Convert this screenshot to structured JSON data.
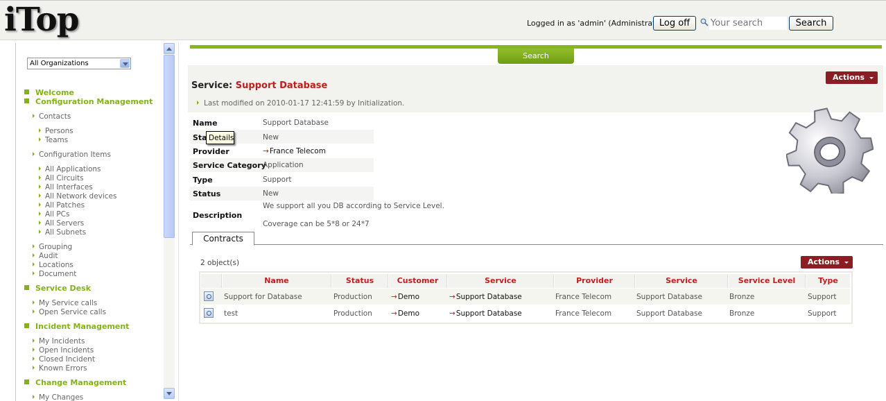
{
  "header": {
    "logo": "iTop",
    "login_text": "Logged in as 'admin' (Administrator)",
    "logoff_label": "Log off",
    "search_placeholder": "Your search",
    "search_button": "Search"
  },
  "sidebar": {
    "org_select": "All Organizations",
    "sections": [
      {
        "label": "Welcome"
      },
      {
        "label": "Configuration Management",
        "items": [
          "Contacts",
          "Persons",
          "Teams",
          "Configuration Items",
          "All Applications",
          "All Circuits",
          "All Interfaces",
          "All Network devices",
          "All Patches",
          "All PCs",
          "All Servers",
          "All Subnets",
          "Grouping",
          "Audit",
          "Locations",
          "Document"
        ]
      },
      {
        "label": "Service Desk",
        "items": [
          "My Service calls",
          "Open Service calls"
        ]
      },
      {
        "label": "Incident Management",
        "items": [
          "My Incidents",
          "Open Incidents",
          "Closed Incident",
          "Known Errors"
        ]
      },
      {
        "label": "Change Management",
        "items": [
          "My Changes"
        ]
      }
    ]
  },
  "main": {
    "search_tab": "Search",
    "actions_label": "Actions",
    "title_prefix": "Service:",
    "title_name": "Support Database",
    "last_modified": "Last modified on 2010-01-17 12:41:59 by Initialization.",
    "tooltip": "Details",
    "details": [
      {
        "label": "Name",
        "value": "Support Database"
      },
      {
        "label": "Sta",
        "value": "New"
      },
      {
        "label": "Provider",
        "value": "France Telecom"
      },
      {
        "label": "Service Category",
        "value": "Application"
      },
      {
        "label": "Type",
        "value": "Support"
      },
      {
        "label": "Status",
        "value": "New"
      },
      {
        "label": "Description",
        "value": "We support all you DB according to Service Level.",
        "value2": "Coverage can be 5*8 or 24*7"
      }
    ],
    "tab_contracts": "Contracts",
    "object_count": "2 object(s)",
    "list": {
      "columns": [
        "Name",
        "Status",
        "Customer",
        "Service",
        "Provider",
        "Service",
        "Service Level",
        "Type"
      ],
      "rows": [
        [
          "Support for Database",
          "Production",
          "Demo",
          "Support Database",
          "France Telecom",
          "Support Database",
          "Bronze",
          "Support"
        ],
        [
          "test",
          "Production",
          "Demo",
          "Support Database",
          "France Telecom",
          "Support Database",
          "Bronze",
          "Support"
        ]
      ]
    }
  },
  "colors": {
    "accent_green": "#83b217",
    "actions_red": "#8a1e22",
    "title_red": "#c01e1e"
  }
}
